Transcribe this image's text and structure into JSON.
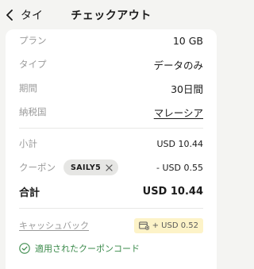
{
  "header": {
    "back_label": "タイ",
    "title": "チェックアウト"
  },
  "details": [
    {
      "label": "プラン",
      "value": "10 GB"
    },
    {
      "label": "タイプ",
      "value": "データのみ"
    },
    {
      "label": "期間",
      "value": "30日間"
    },
    {
      "label": "納税国",
      "value": "マレーシア"
    }
  ],
  "summary": {
    "subtotal_label": "小計",
    "subtotal_value": "USD 10.44",
    "coupon_label": "クーポン",
    "coupon_code": "SAILY5",
    "coupon_value": "- USD 0.55",
    "total_label": "合計",
    "total_value": "USD 10.44"
  },
  "cashback": {
    "label": "キャッシュバック",
    "value": "+ USD 0.52"
  },
  "applied_message": "適用されたクーポンコード",
  "colors": {
    "background": "#f4f4f2",
    "card": "#ffffff",
    "cashback_badge": "#fdf3c8",
    "success": "#3a8a4a"
  }
}
